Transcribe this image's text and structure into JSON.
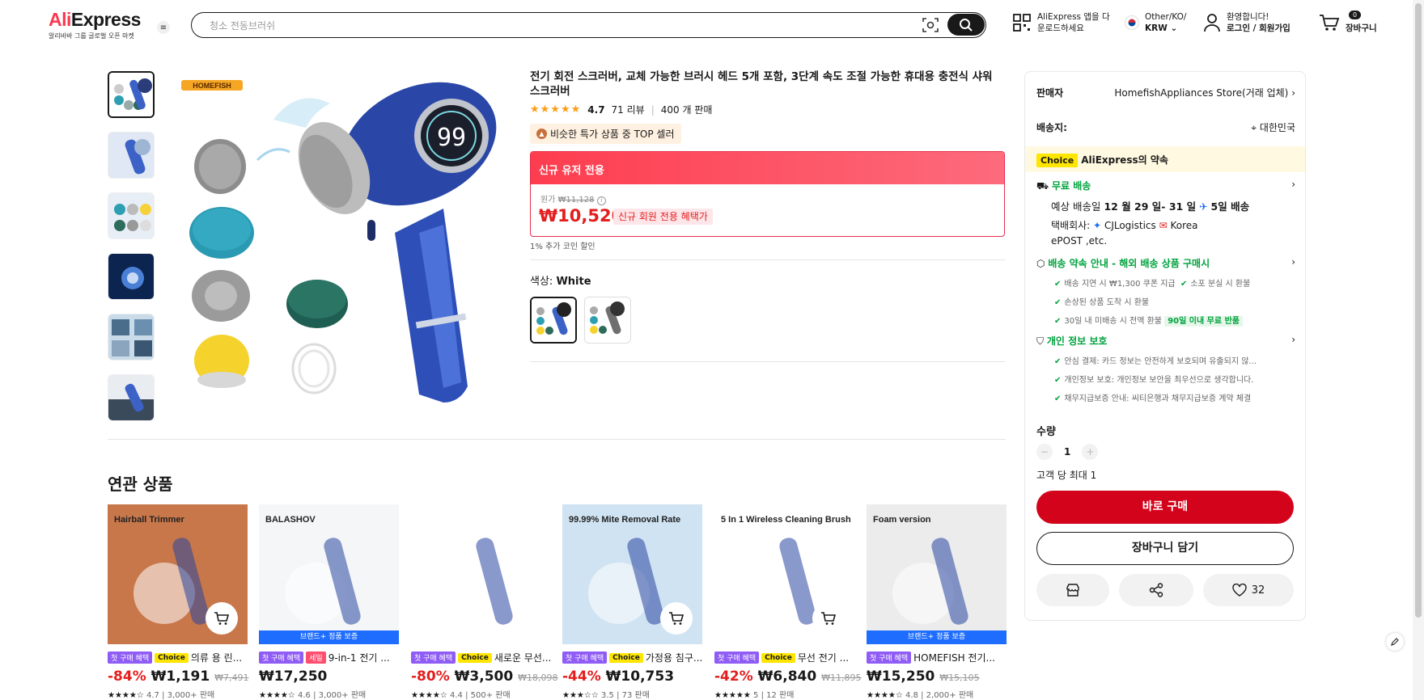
{
  "header": {
    "logo_ali": "Ali",
    "logo_express": "Express",
    "logo_tagline": "알리바바 그룹 글로벌 오픈 마켓",
    "search_placeholder": "청소 전동브러쉬",
    "app_line1": "AliExpress 앱을 다",
    "app_line2": "운로드하세요",
    "region_line1": "Other/KO/",
    "region_line2": "KRW",
    "user_line1": "환영합니다!",
    "user_line2": "로그인 / 회원가입",
    "cart_count": "0",
    "cart_label": "장바구니"
  },
  "product": {
    "brand_logo": "HOMEFISH",
    "title": "전기 회전 스크러버, 교체 가능한 브러시 헤드 5개 포함, 3단계 속도 조절 가능한 휴대용 충전식 샤워 스크러버",
    "rating": "4.7",
    "reviews": "71 리뷰",
    "sold": "400 개 판매",
    "top_seller": "비슷한 특가 상품 중 TOP 셀러",
    "new_user_header": "신규 유저 전용",
    "orig_label": "원가",
    "orig_price": "₩11,128",
    "price": "₩10,520",
    "price_tag": "신규 회원 전용 혜택가",
    "coin": "1% 추가 코인 할인",
    "color_label": "색상:",
    "color_value": "White",
    "display_number": "99"
  },
  "related": {
    "title": "연관 상품",
    "items": [
      {
        "badge1": "첫 구매 혜택",
        "badge2": "Choice",
        "name": "의류 용 린...",
        "disc": "-84%",
        "price": "₩1,191",
        "old": "₩7,491",
        "stars": "★★★★☆",
        "rating": "4.7",
        "sold": "3,000+ 판매",
        "ribbon": "",
        "img_text": "Hairball Trimmer",
        "bg": "#c8774a"
      },
      {
        "badge1": "첫 구매 혜택",
        "badge2": "세일",
        "name": "9-in-1 전기 ...",
        "disc": "",
        "price": "₩17,250",
        "old": "",
        "stars": "★★★★☆",
        "rating": "4.6",
        "sold": "3,000+ 판매",
        "ribbon": "브랜드+ 정품 보증",
        "img_text": "BALASHOV",
        "bg": "#f4f6f8"
      },
      {
        "badge1": "첫 구매 혜택",
        "badge2": "Choice",
        "name": "새로운 무선...",
        "disc": "-80%",
        "price": "₩3,500",
        "old": "₩18,098",
        "stars": "★★★★☆",
        "rating": "4.4",
        "sold": "500+ 판매",
        "ribbon": "",
        "img_text": "",
        "bg": "#ffffff"
      },
      {
        "badge1": "첫 구매 혜택",
        "badge2": "Choice",
        "name": "가정용 침구...",
        "disc": "-44%",
        "price": "₩10,753",
        "old": "",
        "stars": "★★★☆☆",
        "rating": "3.5",
        "sold": "73 판매",
        "ribbon": "",
        "img_text": "99.99% Mite Removal Rate",
        "bg": "#cfe3f2"
      },
      {
        "badge1": "첫 구매 혜택",
        "badge2": "Choice",
        "name": "무선 전기 ...",
        "disc": "-42%",
        "price": "₩6,840",
        "old": "₩11,895",
        "stars": "★★★★★",
        "rating": "5",
        "sold": "12 판매",
        "ribbon": "",
        "img_text": "5 In 1 Wireless Cleaning Brush",
        "bg": "#ffffff"
      },
      {
        "badge1": "첫 구매 혜택",
        "badge2": "",
        "name": "HOMEFISH 전기...",
        "disc": "",
        "price": "₩15,250",
        "old": "₩15,105",
        "stars": "★★★★☆",
        "rating": "4.8",
        "sold": "2,000+ 판매",
        "ribbon": "브랜드+ 정품 보증",
        "img_text": "Foam version",
        "bg": "#ececec"
      }
    ]
  },
  "panel": {
    "seller_label": "판매자",
    "seller_value": "HomefishAppliances Store(거래 업체)",
    "ship_to_label": "배송지:",
    "ship_to_value": "대한민국",
    "choice_badge": "Choice",
    "promise": "AliExpress의 약속",
    "free_ship": "무료 배송",
    "est_pre": "예상 배송일 ",
    "est_date": "12 월 29 일- 31 일",
    "est_days": "5일 배송",
    "carrier_label": "택배회사:",
    "carrier_1": "CJLogistics",
    "carrier_2": "Korea",
    "carrier_3": "ePOST ,etc.",
    "guarantee_title": "배송 약속 안내 - 해외 배송 상품 구매시",
    "g1": "배송 지연 시 ₩1,300 쿠폰 지급",
    "g2": "소포 분실 시 환불",
    "g3": "손상된 상품 도착 시 환불",
    "g4": "30일 내 미배송 시 전액 환불",
    "g4_tag": "90일 이내 무료 반품",
    "privacy_title": "개인 정보 보호",
    "p1": "안심 결제: 카드 정보는 안전하게 보호되며 유출되지 않...",
    "p2": "개인정보 보호: 개인정보 보안을 최우선으로 생각합니다.",
    "p3": "채무지급보증 안내: 씨티은행과 채무지급보증 계약 체결",
    "qty_label": "수량",
    "qty_value": "1",
    "limit": "고객 당 최대 1",
    "buy_now": "바로 구매",
    "add_cart": "장바구니 담기",
    "wish_count": "32"
  }
}
